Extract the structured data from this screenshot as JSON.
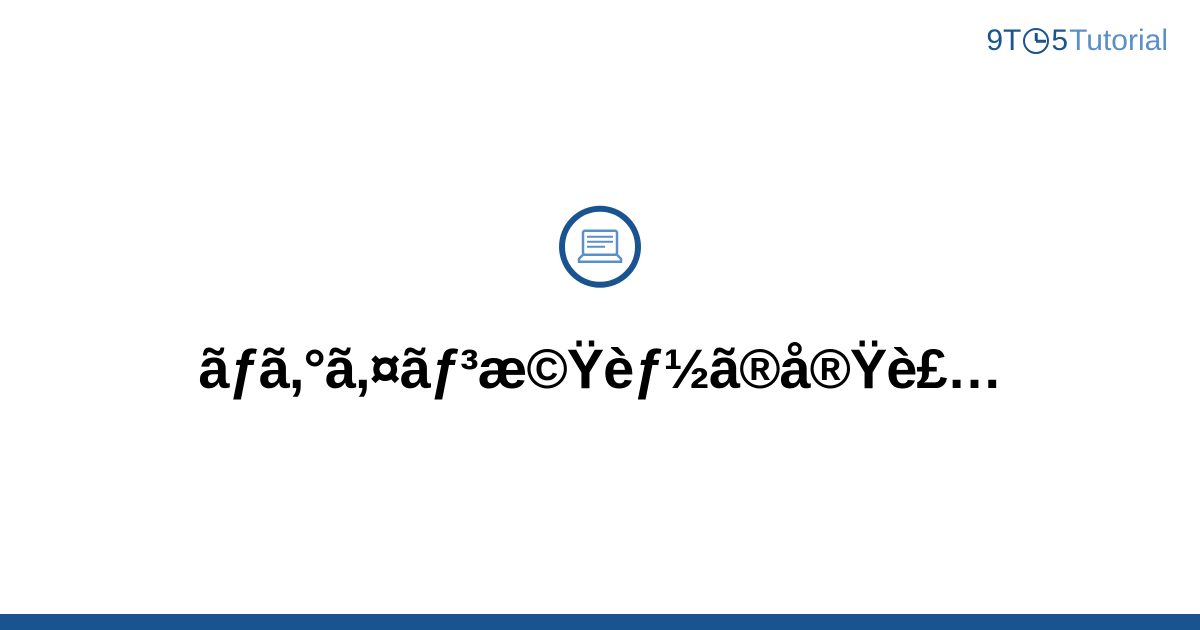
{
  "brand": {
    "prefix": "9T",
    "middle": "5",
    "suffix": "Tutorial"
  },
  "title": "ãƒã,°ã,¤ãƒ³æ©Ÿèƒ½ã®å®Ÿè£…",
  "colors": {
    "primary": "#1a5490",
    "secondary": "#5a8fc7"
  }
}
